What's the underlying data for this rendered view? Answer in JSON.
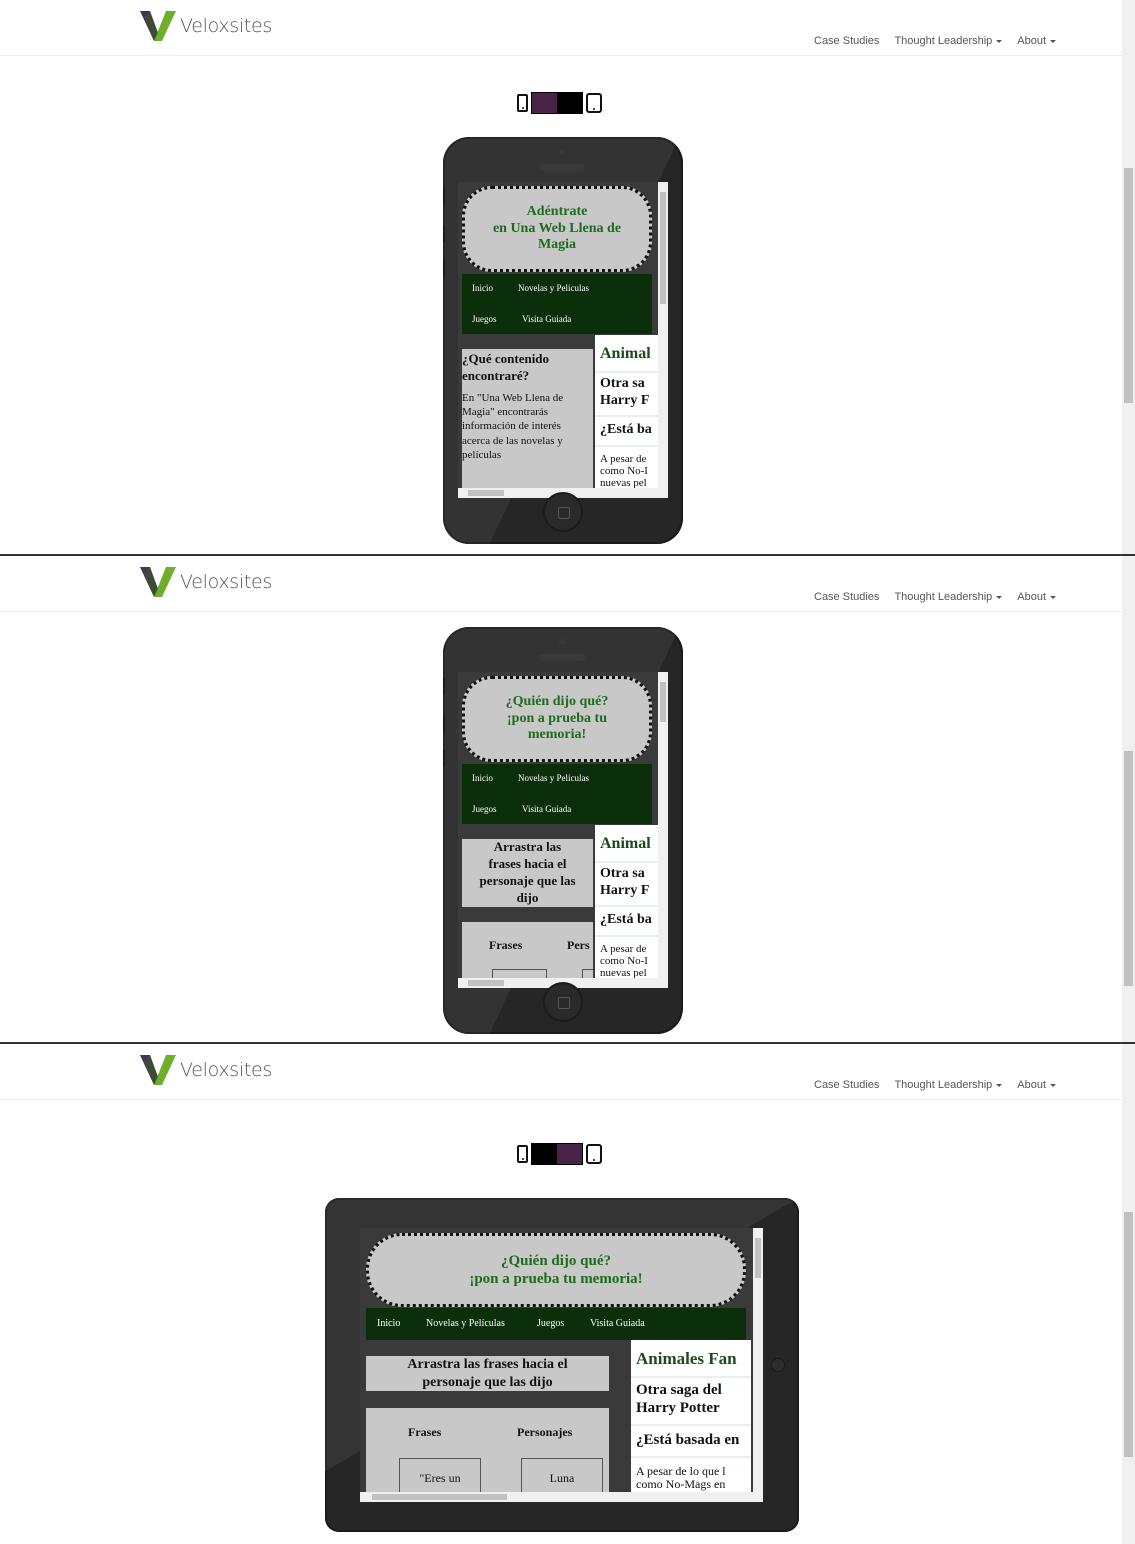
{
  "site": {
    "logo_text": "Veloxsites",
    "nav": {
      "case_studies": "Case Studies",
      "thought_leadership": "Thought Leadership",
      "about": "About"
    }
  },
  "device_toggle": {
    "panel1_active": "phone",
    "panel3_active": "tablet",
    "colors": {
      "active": "#4a2448",
      "inactive": "#000000"
    }
  },
  "panels": [
    {
      "banner": [
        "Adéntrate",
        "en Una Web Llena de",
        "Magia"
      ],
      "nav_row1": [
        "Inicio",
        "Novelas y Películas"
      ],
      "nav_row2": [
        "Juegos",
        "Visita Guiada"
      ],
      "main_heading": "¿Qué contenido encontraré?",
      "main_text": "En \"Una Web Llena de Magia\" encontrarás información de interés acerca de las novelas y películas",
      "right": {
        "title": "Animal",
        "heading1": [
          "Otra sa",
          "Harry F"
        ],
        "heading2": "¿Está ba",
        "para": [
          "A pesar de",
          "como No-I",
          "nuevas pel"
        ]
      }
    },
    {
      "banner": [
        "¿Quién dijo qué?",
        "¡pon a prueba tu",
        "memoria!"
      ],
      "nav_row1": [
        "Inicio",
        "Novelas y Películas"
      ],
      "nav_row2": [
        "Juegos",
        "Visita Guiada"
      ],
      "instruction": [
        "Arrastra las",
        "frases hacia el",
        "personaje que las",
        "dijo"
      ],
      "col_frases": "Frases",
      "col_personajes": "Pers",
      "right": {
        "title": "Animal",
        "heading1": [
          "Otra sa",
          "Harry F"
        ],
        "heading2": "¿Está ba",
        "para": [
          "A pesar de",
          "como No-I",
          "nuevas pel"
        ]
      }
    },
    {
      "banner": [
        "¿Quién dijo qué?",
        "¡pon a prueba tu memoria!"
      ],
      "nav": [
        "Inicio",
        "Novelas y Películas",
        "Juegos",
        "Visita Guiada"
      ],
      "instruction": [
        "Arrastra las frases hacia el",
        "personaje que las dijo"
      ],
      "col_frases": "Frases",
      "col_personajes": "Personajes",
      "phrase_card": "\"Eres un",
      "character_card": "Luna",
      "right": {
        "title": "Animales Fan",
        "heading1": [
          "Otra saga del",
          "Harry Potter"
        ],
        "heading2": "¿Está basada en",
        "para": [
          "A pesar de lo que l",
          "como No-Mags en"
        ]
      }
    }
  ]
}
